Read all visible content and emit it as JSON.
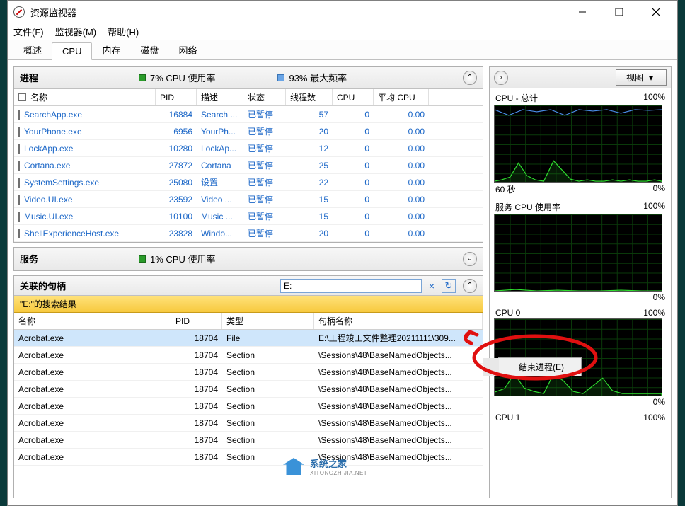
{
  "window": {
    "title": "资源监视器"
  },
  "menu": {
    "file": "文件(F)",
    "monitor": "监视器(M)",
    "help": "帮助(H)"
  },
  "tabs": {
    "overview": "概述",
    "cpu": "CPU",
    "memory": "内存",
    "disk": "磁盘",
    "network": "网络"
  },
  "procPanel": {
    "title": "进程",
    "cpuUsage": "7% CPU 使用率",
    "maxFreq": "93% 最大频率",
    "cols": {
      "name": "名称",
      "pid": "PID",
      "desc": "描述",
      "status": "状态",
      "threads": "线程数",
      "cpu": "CPU",
      "avgcpu": "平均 CPU"
    },
    "rows": [
      {
        "name": "SearchApp.exe",
        "pid": "16884",
        "desc": "Search ...",
        "status": "已暂停",
        "threads": "57",
        "cpu": "0",
        "avg": "0.00"
      },
      {
        "name": "YourPhone.exe",
        "pid": "6956",
        "desc": "YourPh...",
        "status": "已暂停",
        "threads": "20",
        "cpu": "0",
        "avg": "0.00"
      },
      {
        "name": "LockApp.exe",
        "pid": "10280",
        "desc": "LockAp...",
        "status": "已暂停",
        "threads": "12",
        "cpu": "0",
        "avg": "0.00"
      },
      {
        "name": "Cortana.exe",
        "pid": "27872",
        "desc": "Cortana",
        "status": "已暂停",
        "threads": "25",
        "cpu": "0",
        "avg": "0.00"
      },
      {
        "name": "SystemSettings.exe",
        "pid": "25080",
        "desc": "设置",
        "status": "已暂停",
        "threads": "22",
        "cpu": "0",
        "avg": "0.00"
      },
      {
        "name": "Video.UI.exe",
        "pid": "23592",
        "desc": "Video ...",
        "status": "已暂停",
        "threads": "15",
        "cpu": "0",
        "avg": "0.00"
      },
      {
        "name": "Music.UI.exe",
        "pid": "10100",
        "desc": "Music ...",
        "status": "已暂停",
        "threads": "15",
        "cpu": "0",
        "avg": "0.00"
      },
      {
        "name": "ShellExperienceHost.exe",
        "pid": "23828",
        "desc": "Windo...",
        "status": "已暂停",
        "threads": "20",
        "cpu": "0",
        "avg": "0.00"
      }
    ]
  },
  "svcPanel": {
    "title": "服务",
    "cpuUsage": "1% CPU 使用率"
  },
  "handlesPanel": {
    "title": "关联的句柄",
    "searchValue": "E:",
    "clearIcon": "×",
    "resultsLabel": "\"E:\"的搜索结果",
    "cols": {
      "name": "名称",
      "pid": "PID",
      "type": "类型",
      "handle": "句柄名称"
    },
    "rows": [
      {
        "name": "Acrobat.exe",
        "pid": "18704",
        "type": "File",
        "handle": "E:\\工程竣工文件整理20211111\\309..."
      },
      {
        "name": "Acrobat.exe",
        "pid": "18704",
        "type": "Section",
        "handle": "\\Sessions\\48\\BaseNamedObjects..."
      },
      {
        "name": "Acrobat.exe",
        "pid": "18704",
        "type": "Section",
        "handle": "\\Sessions\\48\\BaseNamedObjects..."
      },
      {
        "name": "Acrobat.exe",
        "pid": "18704",
        "type": "Section",
        "handle": "\\Sessions\\48\\BaseNamedObjects..."
      },
      {
        "name": "Acrobat.exe",
        "pid": "18704",
        "type": "Section",
        "handle": "\\Sessions\\48\\BaseNamedObjects..."
      },
      {
        "name": "Acrobat.exe",
        "pid": "18704",
        "type": "Section",
        "handle": "\\Sessions\\48\\BaseNamedObjects..."
      },
      {
        "name": "Acrobat.exe",
        "pid": "18704",
        "type": "Section",
        "handle": "\\Sessions\\48\\BaseNamedObjects..."
      },
      {
        "name": "Acrobat.exe",
        "pid": "18704",
        "type": "Section",
        "handle": "\\Sessions\\48\\BaseNamedObjects..."
      }
    ]
  },
  "right": {
    "viewBtn": "视图",
    "graphs": {
      "cpuTotal": {
        "label": "CPU - 总计",
        "pct": "100%",
        "ftrL": "60 秒",
        "ftrR": "0%"
      },
      "svc": {
        "label": "服务 CPU 使用率",
        "pct": "100%",
        "ftrR": "0%"
      },
      "cpu0": {
        "label": "CPU 0",
        "pct": "100%",
        "ftrR": "0%"
      },
      "cpu1": {
        "label": "CPU 1",
        "pct": "100%"
      }
    }
  },
  "contextMenu": {
    "endProcess": "结束进程(E)"
  },
  "watermark": {
    "text1": "系统之家",
    "text2": "XITONGZHIJIA.NET"
  },
  "chart_data": [
    {
      "type": "line",
      "title": "CPU - 总计",
      "xlabel": "60 秒",
      "ylim": [
        0,
        100
      ],
      "ylabel": "%",
      "series": [
        {
          "name": "CPU 使用率",
          "color": "#2fdf2f",
          "values": [
            2,
            3,
            5,
            25,
            8,
            3,
            2,
            2,
            28,
            15,
            4,
            2,
            2,
            3,
            2,
            2,
            3,
            2,
            3,
            2,
            2,
            3,
            2
          ]
        },
        {
          "name": "最大频率",
          "color": "#4a8de8",
          "values": [
            95,
            88,
            95,
            92,
            95,
            94,
            88,
            95,
            93,
            95,
            90,
            94,
            95,
            93,
            95,
            94,
            95,
            95,
            93,
            95,
            94,
            95,
            95
          ]
        }
      ]
    },
    {
      "type": "line",
      "title": "服务 CPU 使用率",
      "ylim": [
        0,
        100
      ],
      "ylabel": "%",
      "series": [
        {
          "name": "服务 CPU",
          "color": "#2fdf2f",
          "values": [
            1,
            1,
            2,
            1,
            1,
            1,
            1,
            1,
            2,
            1,
            1,
            1,
            1,
            1,
            1,
            1,
            1,
            1,
            1,
            1,
            1,
            1,
            1
          ]
        }
      ]
    },
    {
      "type": "line",
      "title": "CPU 0",
      "ylim": [
        0,
        100
      ],
      "ylabel": "%",
      "series": [
        {
          "name": "CPU 0 使用率",
          "color": "#2fdf2f",
          "values": [
            4,
            8,
            28,
            10,
            6,
            4,
            4,
            6,
            30,
            20,
            6,
            4,
            4,
            12,
            22,
            6,
            4,
            4,
            4,
            4,
            4,
            4,
            4
          ]
        }
      ]
    },
    {
      "type": "line",
      "title": "CPU 1",
      "ylim": [
        0,
        100
      ],
      "ylabel": "%",
      "series": [
        {
          "name": "CPU 1 使用率",
          "color": "#2fdf2f",
          "values": []
        }
      ]
    }
  ]
}
